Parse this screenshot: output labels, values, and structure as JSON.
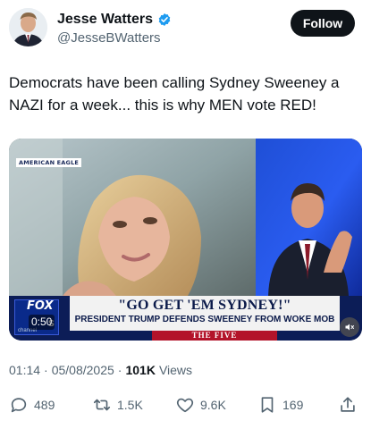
{
  "author": {
    "display_name": "Jesse Watters",
    "handle": "@JesseBWatters",
    "verified": true,
    "follow_label": "Follow"
  },
  "tweet": {
    "text": "Democrats have been calling Sydney Sweeney a NAZI for a week... this is why MEN vote RED!"
  },
  "media": {
    "corner_bug": "AMERICAN EAGLE",
    "network_logo": "FOX",
    "network_sub": "S",
    "network_channel": "channel",
    "duration": "0:50",
    "chyron_title": "\"GO GET 'EM SYDNEY!\"",
    "chyron_subtitle": "PRESIDENT TRUMP DEFENDS SWEENEY FROM WOKE MOB",
    "show_name": "THE FIVE"
  },
  "meta": {
    "time": "01:14",
    "separator": "·",
    "date": "05/08/2025",
    "views_count": "101K",
    "views_label": "Views"
  },
  "actions": {
    "replies": "489",
    "reposts": "1.5K",
    "likes": "9.6K",
    "bookmarks": "169"
  },
  "colors": {
    "verified_blue": "#1d9bf0",
    "text_primary": "#0f1419",
    "text_secondary": "#536471",
    "fox_navy": "#0c1d57",
    "show_red": "#b3132a"
  }
}
